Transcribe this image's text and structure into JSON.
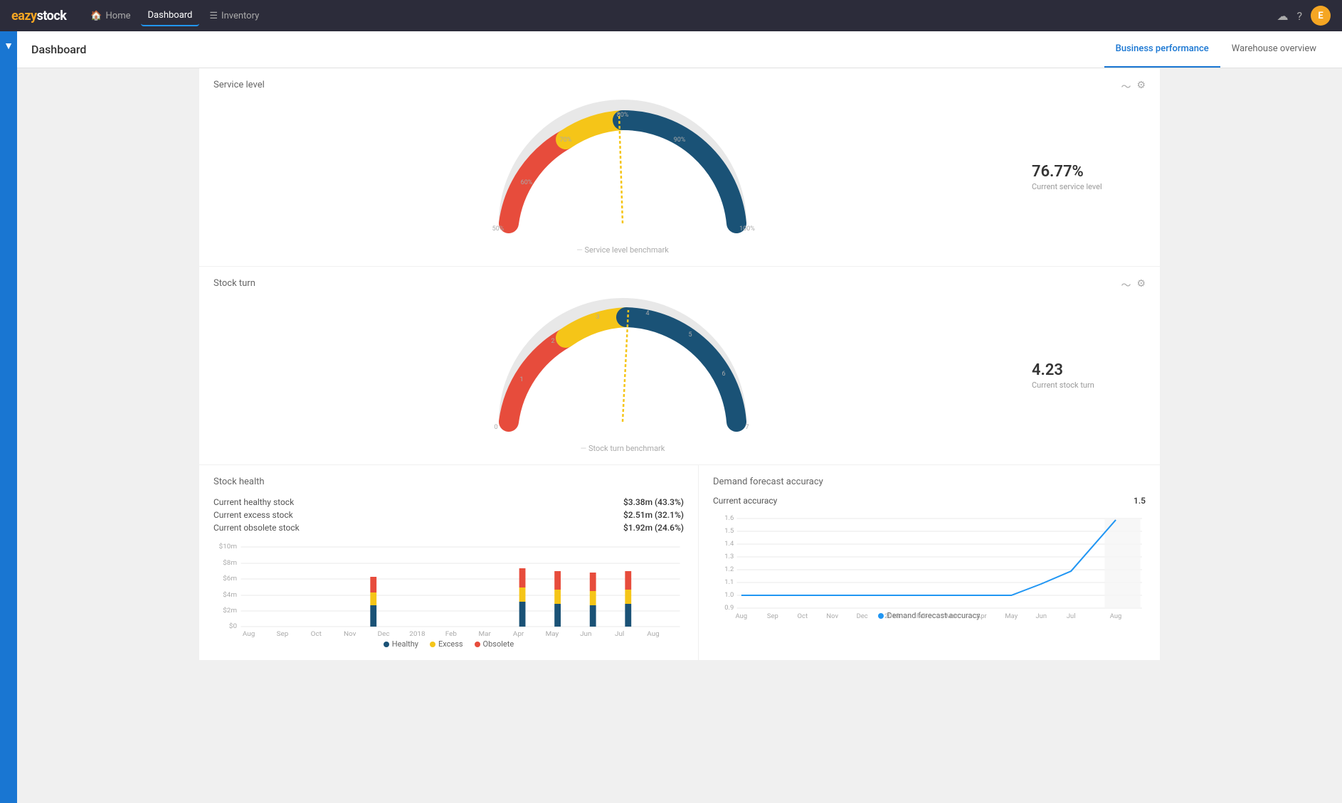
{
  "app": {
    "logo_orange": "eazy",
    "logo_white": "stock",
    "avatar_letter": "E"
  },
  "topnav": {
    "items": [
      {
        "label": "Home",
        "icon": "🏠",
        "active": false
      },
      {
        "label": "Dashboard",
        "icon": "",
        "active": true
      },
      {
        "label": "Inventory",
        "icon": "☰",
        "active": false
      }
    ]
  },
  "header": {
    "title": "Dashboard"
  },
  "tabs": [
    {
      "label": "Business performance",
      "active": true
    },
    {
      "label": "Warehouse overview",
      "active": false
    }
  ],
  "service_level": {
    "title": "Service level",
    "value": "76.77%",
    "label": "Current service level",
    "benchmark_label": "Service level benchmark",
    "gauge_min": 50,
    "gauge_max": 100,
    "ticks": [
      "50%",
      "60%",
      "70%",
      "80%",
      "90%",
      "100%"
    ],
    "current": 76.77
  },
  "stock_turn": {
    "title": "Stock turn",
    "value": "4.23",
    "label": "Current stock turn",
    "benchmark_label": "Stock turn benchmark",
    "gauge_min": 0,
    "gauge_max": 7,
    "ticks": [
      "0",
      "1",
      "2",
      "3",
      "4",
      "5",
      "6",
      "7"
    ],
    "current": 4.23
  },
  "stock_health": {
    "title": "Stock health",
    "stats": [
      {
        "label": "Current healthy stock",
        "value": "$3.38m (43.3%)"
      },
      {
        "label": "Current excess stock",
        "value": "$2.51m (32.1%)"
      },
      {
        "label": "Current obsolete stock",
        "value": "$1.92m (24.6%)"
      }
    ],
    "y_axis": [
      "$10m",
      "$8m",
      "$6m",
      "$4m",
      "$2m",
      "$0"
    ],
    "x_axis": [
      "Aug",
      "Sep",
      "Oct",
      "Nov",
      "Dec",
      "2018",
      "Feb",
      "Mar",
      "Apr",
      "May",
      "Jun",
      "Jul",
      "Aug"
    ],
    "legend": [
      {
        "label": "Healthy",
        "color": "#1a5276"
      },
      {
        "label": "Excess",
        "color": "#f5c518"
      },
      {
        "label": "Obsolete",
        "color": "#e74c3c"
      }
    ]
  },
  "demand_forecast": {
    "title": "Demand forecast accuracy",
    "current_label": "Current accuracy",
    "current_value": "1.5",
    "y_axis": [
      "1.6",
      "1.5",
      "1.4",
      "1.3",
      "1.2",
      "1.1",
      "1.0",
      "0.9"
    ],
    "x_axis": [
      "Aug",
      "Sep",
      "Oct",
      "Nov",
      "Dec",
      "2018",
      "Feb",
      "Mar",
      "Apr",
      "May",
      "Jun",
      "Jul",
      "Aug"
    ],
    "legend": [
      {
        "label": "Demand forecast accuracy",
        "color": "#2196f3"
      }
    ]
  }
}
